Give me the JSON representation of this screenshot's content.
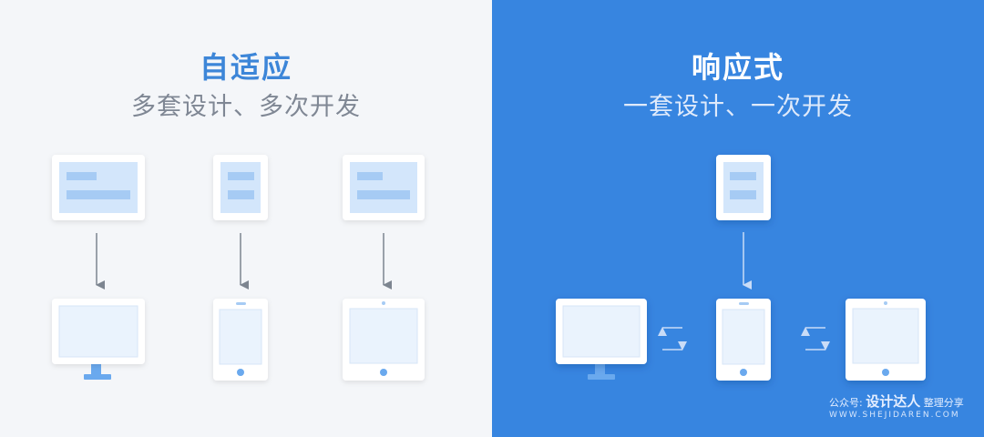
{
  "left": {
    "title": "自适应",
    "subtitle": "多套设计、多次开发"
  },
  "right": {
    "title": "响应式",
    "subtitle": "一套设计、一次开发"
  },
  "watermark": {
    "prefix": "公众号:",
    "name": "设计达人",
    "suffix": "整理分享",
    "url": "WWW.SHEJIDAREN.COM"
  },
  "colors": {
    "left_background": "#f4f6f9",
    "right_background": "#3785e0",
    "accent_blue": "#3d86d8",
    "device_body": "#ffffff",
    "screen_fill": "#eaf3fd",
    "wireframe_block": "#a6cbf4",
    "stand": "#6aa9ee",
    "arrow_left_panel": "#7d8590",
    "arrow_right_panel": "#c9dcf7"
  }
}
